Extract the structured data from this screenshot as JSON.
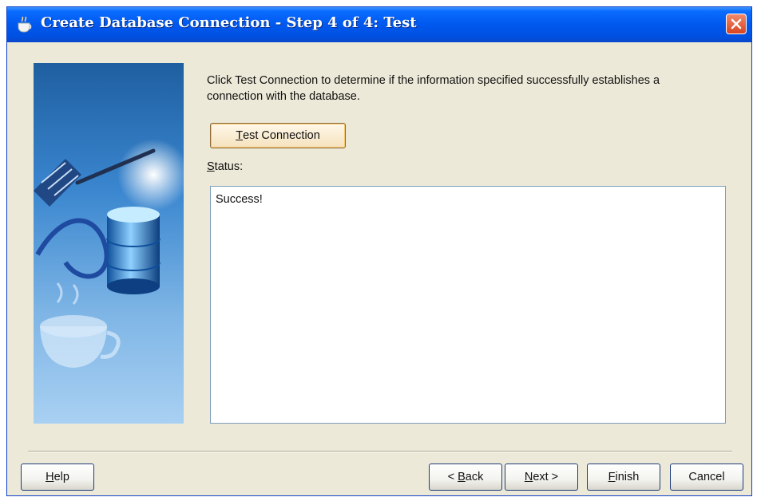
{
  "window": {
    "title": "Create Database Connection - Step 4 of 4: Test"
  },
  "content": {
    "intro_text": "Click Test Connection to determine if the information specified successfully establishes a connection with the database.",
    "test_button": {
      "mnemonic": "T",
      "rest": "est Connection"
    },
    "status_label": {
      "mnemonic": "S",
      "rest": "tatus:"
    },
    "status_text": "Success!"
  },
  "footer": {
    "help": {
      "mnemonic": "H",
      "rest": "elp"
    },
    "back": {
      "prefix": "< ",
      "mnemonic": "B",
      "rest": "ack"
    },
    "next": {
      "mnemonic": "N",
      "rest": "ext >"
    },
    "finish": {
      "mnemonic": "F",
      "rest": "inish"
    },
    "cancel": {
      "label": "Cancel"
    }
  }
}
